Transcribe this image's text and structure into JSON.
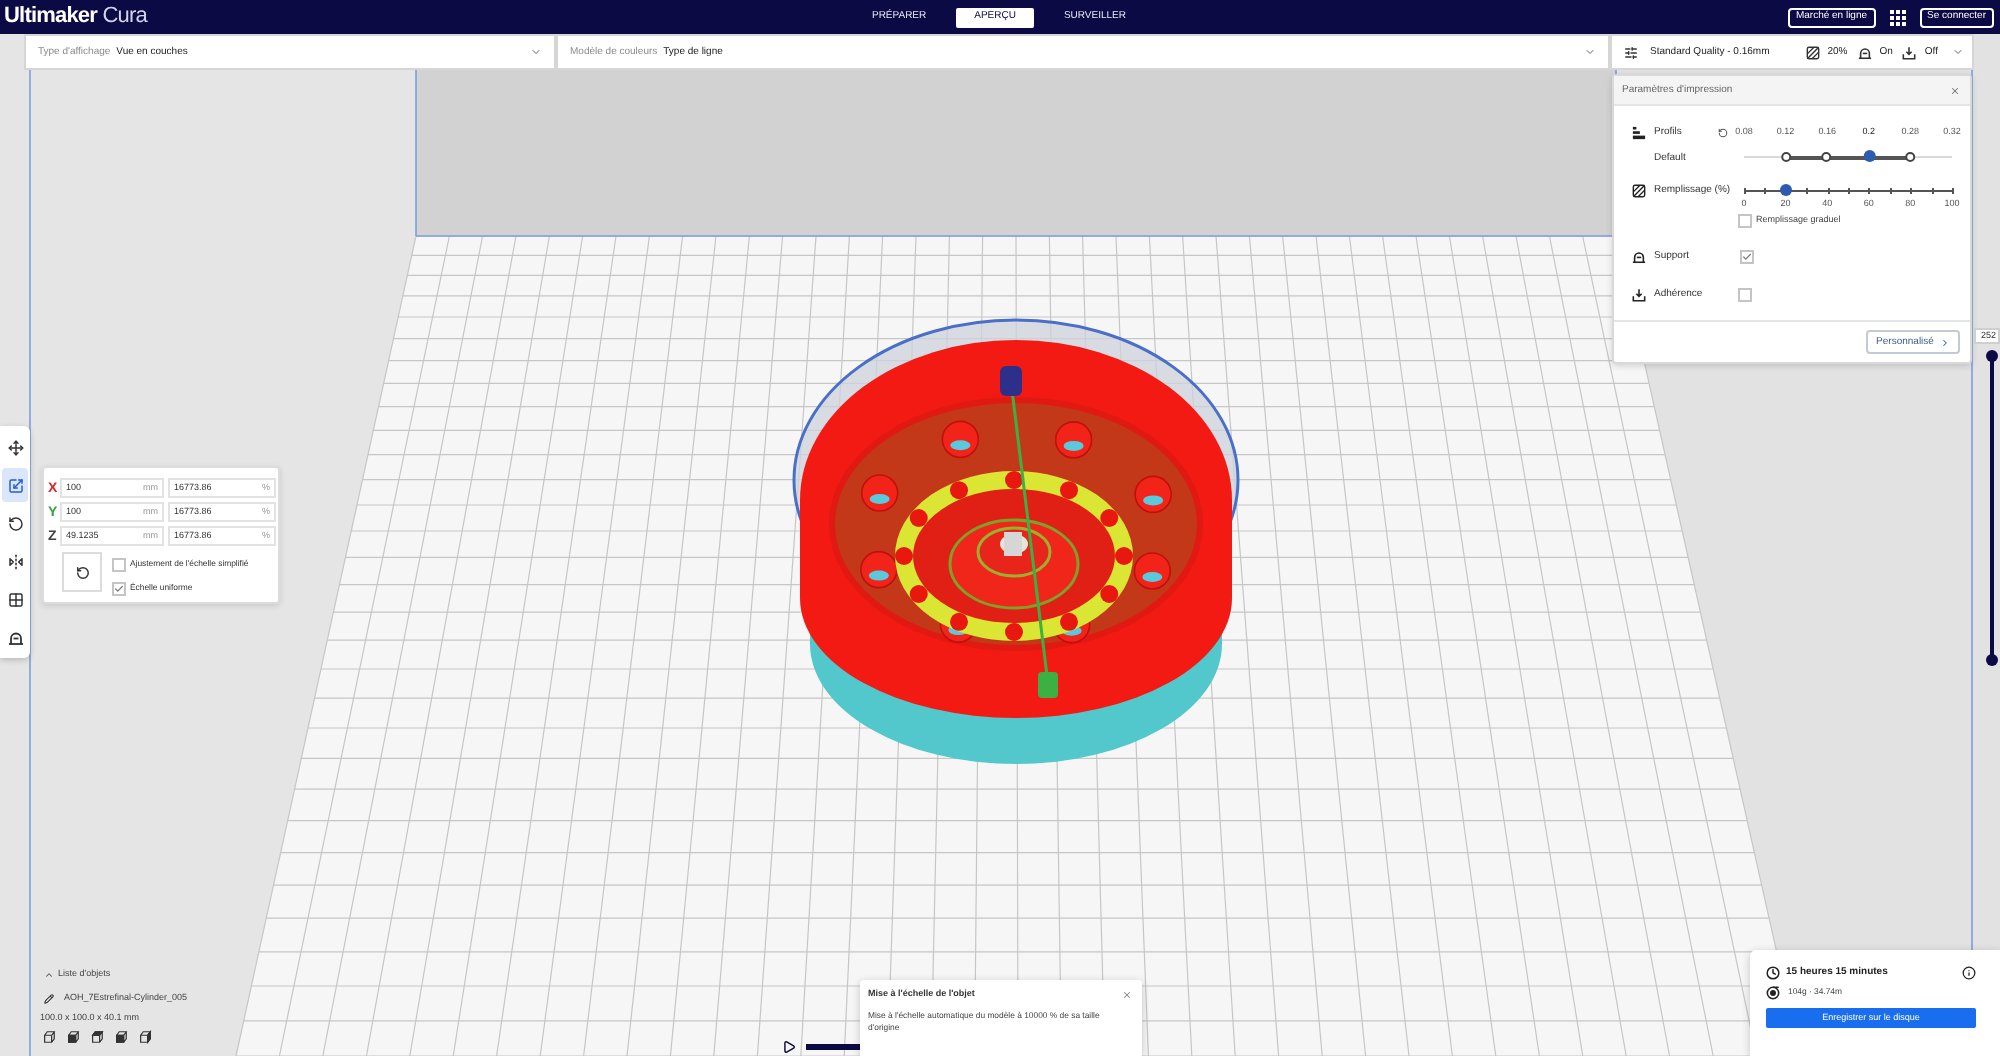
{
  "header": {
    "logo": {
      "brand": "Ultimaker",
      "product": "Cura"
    },
    "stages": [
      {
        "label": "PRÉPARER",
        "selected": false
      },
      {
        "label": "APERÇU",
        "selected": true
      },
      {
        "label": "SURVEILLER",
        "selected": false
      }
    ],
    "marketplace_button": "Marché en ligne",
    "sign_in_button": "Se connecter"
  },
  "view_bar": {
    "view_type": {
      "label": "Type d'affichage",
      "value": "Vue en couches"
    },
    "color_scheme": {
      "label": "Modèle de couleurs",
      "value": "Type de ligne"
    },
    "print_setup": {
      "profile": "Standard Quality - 0.16mm",
      "infill": "20%",
      "support": "On",
      "adhesion": "Off"
    }
  },
  "print_settings": {
    "title": "Paramètres d'impression",
    "profiles": {
      "label": "Profils",
      "name": "Default",
      "layer_heights": [
        {
          "label": "0.08",
          "available": false,
          "selected": false
        },
        {
          "label": "0.12",
          "available": true,
          "selected": false
        },
        {
          "label": "0.16",
          "available": true,
          "selected": false
        },
        {
          "label": "0.2",
          "available": true,
          "selected": true
        },
        {
          "label": "0.28",
          "available": true,
          "selected": false
        },
        {
          "label": "0.32",
          "available": false,
          "selected": false
        }
      ]
    },
    "infill": {
      "label": "Remplissage (%)",
      "level": 0.2,
      "ticks": [
        "0",
        "20",
        "40",
        "60",
        "80",
        "100"
      ],
      "gradual": {
        "label": "Remplissage graduel",
        "checked": false
      }
    },
    "support": {
      "label": "Support",
      "checked": true
    },
    "adhesion": {
      "label": "Adhérence",
      "checked": false
    },
    "custom_button": "Personnalisé"
  },
  "tools": [
    {
      "kind": "move",
      "selected": false
    },
    {
      "kind": "scale",
      "selected": true
    },
    {
      "kind": "rotate",
      "selected": false
    },
    {
      "kind": "mirror",
      "selected": false
    },
    {
      "kind": "per_model",
      "selected": false
    },
    {
      "kind": "support_blocker",
      "selected": false
    }
  ],
  "scale_panel": {
    "axes": [
      {
        "label": "X",
        "color": "#d9262b",
        "value": "100",
        "unit": "mm",
        "percent": "16773.86",
        "percent_unit": "%"
      },
      {
        "label": "Y",
        "color": "#2ea043",
        "value": "100",
        "unit": "mm",
        "percent": "16773.86",
        "percent_unit": "%"
      },
      {
        "label": "Z",
        "color": "#404040",
        "value": "49.1235",
        "unit": "mm",
        "percent": "16773.86",
        "percent_unit": "%"
      }
    ],
    "options": [
      {
        "label": "Ajustement de l'échelle simplifié",
        "checked": false
      },
      {
        "label": "Échelle uniforme",
        "checked": true
      }
    ]
  },
  "layer_slider": {
    "label": "252"
  },
  "object_list": {
    "title": "Liste d'objets",
    "object_name": "AOH_7Estrefinal-Cylinder_005",
    "dimensions": "100.0 x 100.0 x 40.1 mm"
  },
  "notification": {
    "title": "Mise à l'échelle de l'objet",
    "message": "Mise à l'échelle automatique du modèle à 10000 % de sa taille d'origine"
  },
  "print_estimate": {
    "time": "15 heures 15 minutes",
    "material": "104g · 34.74m",
    "save_button": "Enregistrer sur le disque"
  }
}
